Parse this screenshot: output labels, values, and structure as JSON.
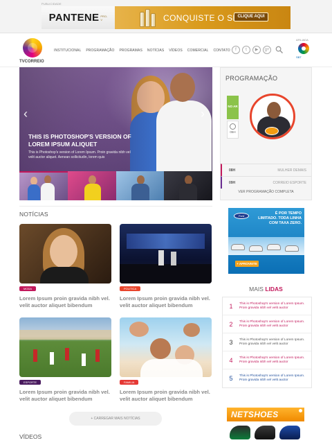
{
  "ad_top": {
    "label": "PUBLICIDADE",
    "brand": "PANTENE",
    "brand_sub": "PRO-V",
    "headline": "CONQUISTE O SEU.",
    "cta": "CLIQUE AQUI"
  },
  "header": {
    "logo_text": "TVCORREIO",
    "nav": [
      "INSTITUCIONAL",
      "PROGRAMAÇÃO",
      "PROGRAMAS",
      "NOTÍCIAS",
      "VÍDEOS",
      "COMERCIAL",
      "CONTATO"
    ],
    "social": [
      "f",
      "t",
      "▶",
      "g+"
    ],
    "affiliate_label": "AFILIADA",
    "affiliate_text": "SBT"
  },
  "hero": {
    "title": "THIS IS PHOTOSHOP'S VERSION OF LOREM IPSUM ALIQUET",
    "description": "This is Photoshop's version of Lorem Ipsum. Proin gravida nibh vel velit auctor aliquet. Aenean sollicitudin, lorem quis",
    "prev": "‹",
    "next": "›"
  },
  "programacao": {
    "title": "PROGRAMAÇÃO",
    "on_air": "NO AR",
    "clock_time": "05H",
    "schedule": [
      {
        "time": "08H",
        "show": "MULHER DEMAIS"
      },
      {
        "time": "09H",
        "show": "CORREIO ESPORTE"
      }
    ],
    "more": "VER PROGRAMAÇÃO COMPLETA"
  },
  "noticias": {
    "title": "NOTÍCIAS",
    "items": [
      {
        "tag": "MODA",
        "text": "Lorem Ipsum proin gravida nibh vel. velit auctor aliquet bibendum"
      },
      {
        "tag": "POLITICA",
        "text": "Lorem Ipsum proin gravida nibh vel. velit auctor aliquet bibendum"
      },
      {
        "tag": "ESPORTE",
        "text": "Lorem Ipsum proin gravida nibh vel. velit auctor aliquet bibendum"
      },
      {
        "tag": "FAMILIA",
        "text": "Lorem Ipsum proin gravida nibh vel. velit auctor aliquet bibendum"
      }
    ],
    "tag_colors": {
      "MODA": "#c2185b",
      "POLITICA": "#e8452c",
      "ESPORTE": "#4a1b5f",
      "FAMILIA": "#e53935"
    },
    "load_more": "+ CARREGAR MAIS NOTÍCIAS"
  },
  "ford_ad": {
    "logo": "Ford",
    "headline": "É POR TEMPO LIMITADO. TODA LINHA COM TAXA ZERO.",
    "cta": "+ APROVEITE"
  },
  "mais_lidas": {
    "title_prefix": "MAIS",
    "title_bold": "LIDAS",
    "items": [
      {
        "num": "1",
        "text": "This is Photoshop's version of Lorem Ipsum. Proin gravida nibh vel velit auctor"
      },
      {
        "num": "2",
        "text": "This is Photoshop's version of Lorem Ipsum. Proin gravida nibh vel velit auctor"
      },
      {
        "num": "3",
        "text": "This is Photoshop's version of Lorem Ipsum. Proin gravida nibh vel velit auctor"
      },
      {
        "num": "4",
        "text": "This is Photoshop's version of Lorem Ipsum. Proin gravida nibh vel velit auctor"
      },
      {
        "num": "5",
        "text": "This is Photoshop's version of Lorem Ipsum. Proin gravida nibh vel velit auctor"
      }
    ]
  },
  "netshoes": {
    "logo": "NETSHOES"
  },
  "videos": {
    "title": "VÍDEOS"
  },
  "colors": {
    "accent": "#c2185b",
    "on_air": "#8bc34a",
    "host_ring": "#e8452c",
    "netshoes": "#f08a00",
    "ford": "#0b6fb5"
  }
}
